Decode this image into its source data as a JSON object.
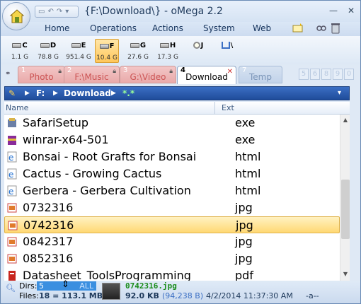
{
  "window": {
    "title": "{F:\\Download\\} - oMega 2.2"
  },
  "menu": [
    "Home",
    "Operations",
    "Actions",
    "System",
    "Web"
  ],
  "drives": [
    {
      "letter": "C",
      "size": "1.1 G"
    },
    {
      "letter": "D",
      "size": "78.8 G"
    },
    {
      "letter": "E",
      "size": "951.4 G"
    },
    {
      "letter": "F",
      "size": "10.4 G",
      "selected": true
    },
    {
      "letter": "G",
      "size": "27.6 G"
    },
    {
      "letter": "H",
      "size": "17.3 G"
    },
    {
      "letter": "J",
      "size": ""
    },
    {
      "letter": "\\",
      "size": ""
    }
  ],
  "tabs": [
    {
      "num": "1",
      "label": "Photo"
    },
    {
      "num": "2",
      "label": "F:\\Music"
    },
    {
      "num": "3",
      "label": "G:\\Video"
    },
    {
      "num": "4",
      "label": "Download",
      "active": true
    },
    {
      "num": "7",
      "label": "Temp"
    }
  ],
  "tab_numbers": [
    "5",
    "6",
    "8",
    "9",
    "0"
  ],
  "path": {
    "drive": "F:",
    "folder": "Download",
    "wild": "*.*"
  },
  "columns": {
    "name": "Name",
    "ext": "Ext"
  },
  "files": [
    {
      "name": "SafariSetup",
      "ext": "exe",
      "icon": "installer-icon"
    },
    {
      "name": "winrar-x64-501",
      "ext": "exe",
      "icon": "archive-icon"
    },
    {
      "name": "Bonsai - Root Grafts for Bonsai",
      "ext": "html",
      "icon": "html-icon"
    },
    {
      "name": "Cactus - Growing Cactus",
      "ext": "html",
      "icon": "html-icon"
    },
    {
      "name": "Gerbera - Gerbera Cultivation",
      "ext": "html",
      "icon": "html-icon"
    },
    {
      "name": "0732316",
      "ext": "jpg",
      "icon": "image-icon"
    },
    {
      "name": "0742316",
      "ext": "jpg",
      "icon": "image-icon",
      "selected": true
    },
    {
      "name": "0842317",
      "ext": "jpg",
      "icon": "image-icon"
    },
    {
      "name": "0852316",
      "ext": "jpg",
      "icon": "image-icon"
    },
    {
      "name": "Datasheet_ToolsProgramming",
      "ext": "pdf",
      "icon": "pdf-icon"
    }
  ],
  "status": {
    "dirs_label": "Dirs:",
    "dirs_value": "5",
    "all_label": "ALL",
    "files_label": "Files:",
    "files_value": "18 = 113.1 MB",
    "selected_name": "0742316.jpg",
    "selected_size": "92.0 KB",
    "selected_bytes": "(94,238 B)",
    "selected_date": "4/2/2014 11:37:30 AM",
    "attributes": "-a--"
  }
}
